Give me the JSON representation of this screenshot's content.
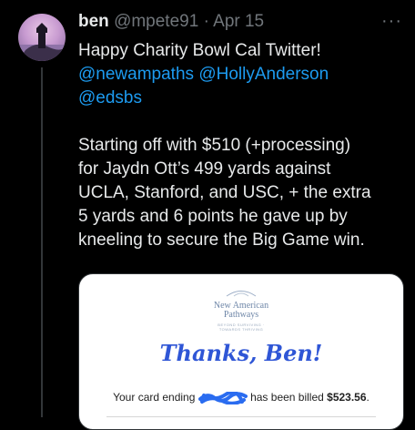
{
  "tweet": {
    "display_name": "ben",
    "handle": "@mpete91",
    "separator": "·",
    "date": "Apr 15",
    "more_label": "···",
    "line1": "Happy Charity Bowl Cal Twitter!",
    "mention1": "@newampaths",
    "mention2": "@HollyAnderson",
    "mention3": "@edsbs",
    "paragraph": [
      "Starting off with $510 (+processing)",
      "for Jaydn Ott’s 499 yards against",
      "UCLA, Stanford, and USC, + the extra",
      "5 yards and 6 points he gave up by",
      "kneeling to secure the Big Game win."
    ]
  },
  "media": {
    "org_line1": "New American",
    "org_line2": "Pathways",
    "org_tagline": "BEYOND SURVIVING · TOWARDS THRIVING",
    "thanks": "Thanks, Ben!",
    "billed_prefix": "Your card ending ",
    "billed_middle": " has been billed ",
    "billed_amount": "$523.56",
    "billed_suffix": "."
  },
  "colors": {
    "accent": "#1d9bf0",
    "thanks": "#2f56d6",
    "redaction": "#2a6cf0"
  }
}
